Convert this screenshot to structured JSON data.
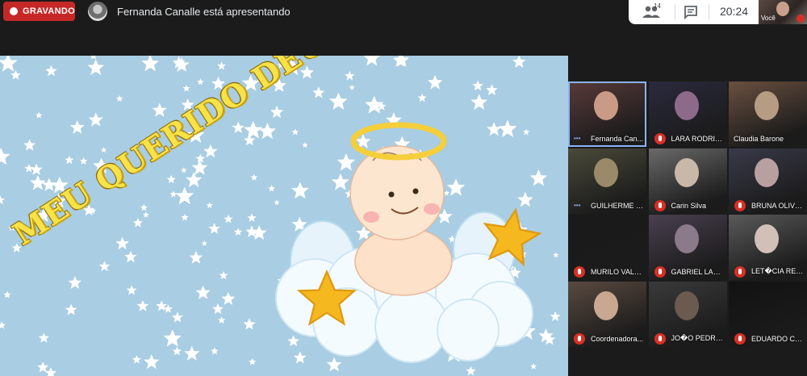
{
  "topbar": {
    "recording_label": "GRAVANDO",
    "presenting_text": "Fernanda Canalle está apresentando",
    "people_count": "14",
    "clock": "20:24",
    "self_label": "Você"
  },
  "slide": {
    "title": "MEU QUERIDO DEUS",
    "colors": {
      "background": "#a9cde3",
      "title": "#f7e24a",
      "star": "#f5b81f"
    }
  },
  "participants": [
    {
      "name": "Fernanda Can...",
      "muted": false,
      "talking": true
    },
    {
      "name": "LARA RODRIG...",
      "muted": true
    },
    {
      "name": "Claudia Barone",
      "muted": false
    },
    {
      "name": "GUILHERME S...",
      "muted": false,
      "talking": true
    },
    {
      "name": "Carin Silva",
      "muted": true
    },
    {
      "name": "BRUNA OLIVE...",
      "muted": true
    },
    {
      "name": "MURILO VALL...",
      "muted": true
    },
    {
      "name": "GABRIEL LAN...",
      "muted": true
    },
    {
      "name": "LET�CIA REB...",
      "muted": true
    },
    {
      "name": "Coordenadora...",
      "muted": true
    },
    {
      "name": "JO�O PEDRO...",
      "muted": true
    },
    {
      "name": "EDUARDO CO...",
      "muted": true
    }
  ],
  "icons": [
    "people-icon",
    "chat-icon",
    "mic-off-icon",
    "record-dot-icon"
  ]
}
